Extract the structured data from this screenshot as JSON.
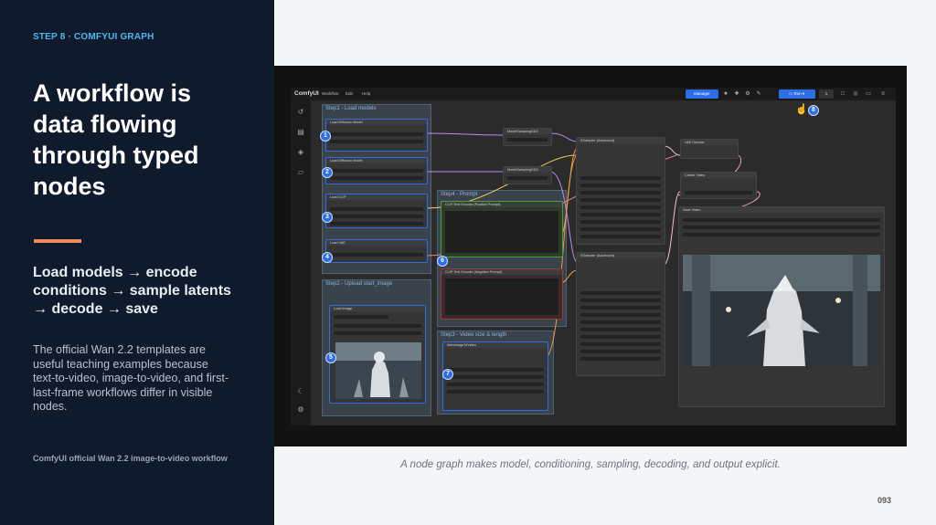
{
  "left_panel": {
    "step_label": "STEP 8 · COMFYUI GRAPH",
    "headline_lines": [
      "A workflow is",
      "data flowing",
      "through typed",
      "nodes"
    ],
    "flow_lines": [
      "Load models → encode",
      "conditions → sample latents",
      "→ decode → save"
    ],
    "description": "The official Wan 2.2 templates are useful teaching examples because text-to-video, image-to-video, and first-last-frame workflows differ in visible nodes.",
    "source": "ComfyUI official Wan 2.2 image-to-video workflow",
    "accent_color": "#ee8a5e",
    "step_color": "#4fb6ee"
  },
  "comfy": {
    "app_name": "ComfyUI",
    "menus": [
      "Workflow",
      "Edit",
      "Help"
    ],
    "manager_label": "Manager",
    "run_label": "Run",
    "batch_count": "1",
    "groups": {
      "step1": "Step1 - Load models",
      "step2": "Step2 - Upload start_image",
      "step4": "Step4 - Prompt",
      "step3": "Step3 - Video size & length"
    },
    "nodes": {
      "load_diffusion_1": "Load Diffusion Model",
      "load_diffusion_2": "Load Diffusion Model",
      "load_clip": "Load CLIP",
      "load_vae": "Load VAE",
      "load_image": "Load Image",
      "clip_pos": "CLIP Text Encode (Positive Prompt)",
      "clip_neg": "CLIP Text Encode (Negative Prompt)",
      "wan_i2v": "WanImageToVideo",
      "model_sampling_1": "ModelSamplingSD3",
      "model_sampling_2": "ModelSamplingSD3",
      "ksampler_1": "KSampler (Advanced)",
      "ksampler_2": "KSampler (Advanced)",
      "vae_decode": "VAE Decode",
      "create_video": "Create Video",
      "save_video": "Save Video"
    },
    "badges": [
      "1",
      "2",
      "3",
      "4",
      "5",
      "6",
      "7",
      "8"
    ]
  },
  "caption": "A node graph makes model, conditioning, sampling, decoding, and output explicit.",
  "page_number": "093"
}
